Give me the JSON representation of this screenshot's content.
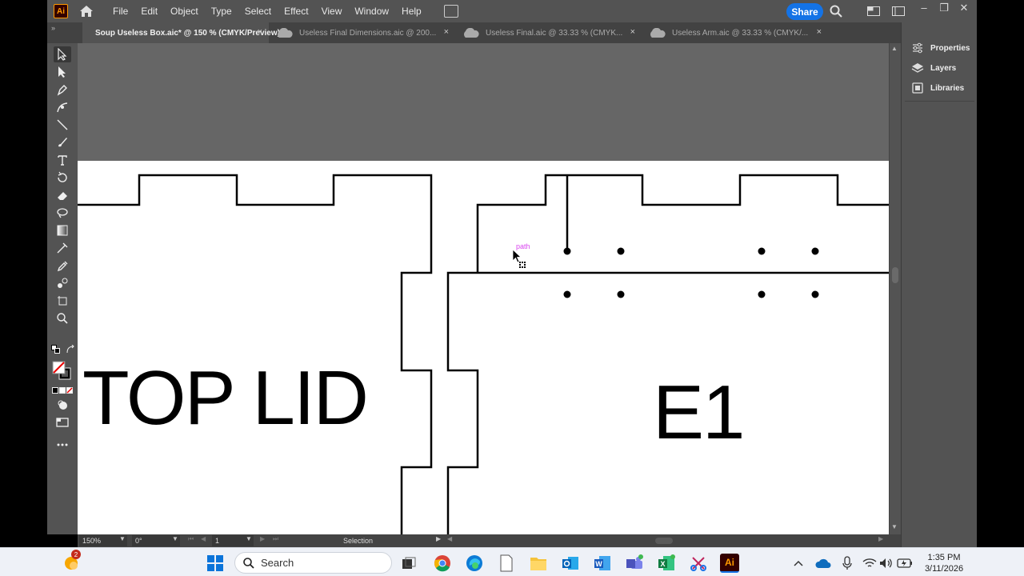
{
  "app": {
    "logo_text": "Ai"
  },
  "menu": [
    "File",
    "Edit",
    "Object",
    "Type",
    "Select",
    "Effect",
    "View",
    "Window",
    "Help"
  ],
  "share_label": "Share",
  "tabs": [
    {
      "label": "Soup Useless Box.aic* @ 150 % (CMYK/Preview)",
      "active": true
    },
    {
      "label": "Useless Final Dimensions.aic @ 200...",
      "active": false
    },
    {
      "label": "Useless Final.aic @ 33.33 % (CMYK...",
      "active": false
    },
    {
      "label": "Useless Arm.aic @ 33.33 % (CMYK/...",
      "active": false
    }
  ],
  "tab_close_glyph": "×",
  "right_panel": {
    "items": [
      {
        "label": "Properties",
        "icon": "sliders-icon"
      },
      {
        "label": "Layers",
        "icon": "layers-icon"
      },
      {
        "label": "Libraries",
        "icon": "libraries-icon"
      }
    ]
  },
  "canvas": {
    "top_label": "TOP LID",
    "e1_label": "E1",
    "smart_guide": "path"
  },
  "status": {
    "zoom": "150%",
    "rotation": "0°",
    "artboard": "1",
    "tool": "Selection"
  },
  "taskbar": {
    "search_label": "Search",
    "notification_count": "2",
    "time": "1:35 PM",
    "date": "3/11/2026"
  },
  "colors": {
    "accent": "#1473e6",
    "guide": "#d946ef",
    "chrome": "#535353",
    "pasteboard": "#666666"
  }
}
